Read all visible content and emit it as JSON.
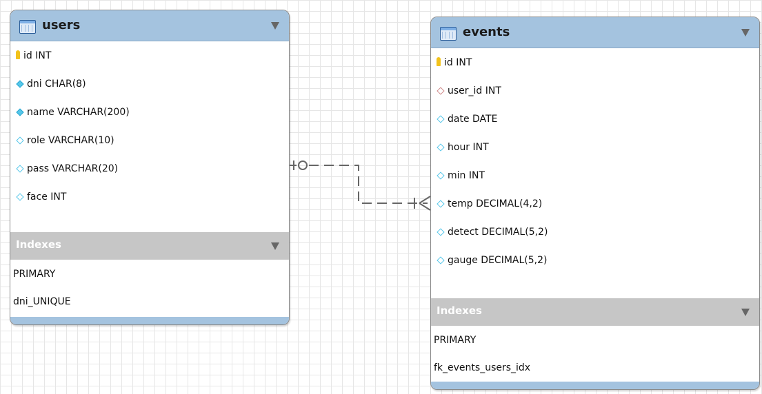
{
  "tables": {
    "users": {
      "name": "users",
      "columns": [
        {
          "text": "id INT",
          "icon": "primary-key-icon"
        },
        {
          "text": "dni CHAR(8)",
          "icon": "not-null-column-icon"
        },
        {
          "text": "name VARCHAR(200)",
          "icon": "not-null-column-icon"
        },
        {
          "text": "role VARCHAR(10)",
          "icon": "nullable-column-icon"
        },
        {
          "text": "pass VARCHAR(20)",
          "icon": "nullable-column-icon"
        },
        {
          "text": "face INT",
          "icon": "nullable-column-icon"
        }
      ],
      "indexes_label": "Indexes",
      "indexes": [
        "PRIMARY",
        "dni_UNIQUE"
      ]
    },
    "events": {
      "name": "events",
      "columns": [
        {
          "text": "id INT",
          "icon": "primary-key-icon"
        },
        {
          "text": "user_id INT",
          "icon": "foreign-key-column-icon"
        },
        {
          "text": "date DATE",
          "icon": "nullable-column-icon"
        },
        {
          "text": "hour INT",
          "icon": "nullable-column-icon"
        },
        {
          "text": "min INT",
          "icon": "nullable-column-icon"
        },
        {
          "text": "temp DECIMAL(4,2)",
          "icon": "nullable-column-icon"
        },
        {
          "text": "detect DECIMAL(5,2)",
          "icon": "nullable-column-icon"
        },
        {
          "text": "gauge DECIMAL(5,2)",
          "icon": "nullable-column-icon"
        }
      ],
      "indexes_label": "Indexes",
      "indexes": [
        "PRIMARY",
        "fk_events_users_idx"
      ]
    }
  },
  "relationship": {
    "from": "users",
    "to": "events",
    "from_cardinality": "zero-or-one",
    "to_cardinality": "one-or-many",
    "line_style": "dashed"
  },
  "colors": {
    "header": "#a4c3df",
    "index_header": "#c6c6c6",
    "primary_key": "#f2c21b",
    "column_diamond": "#56c7ea",
    "foreign_key_diamond": "#d08a8a",
    "relationship_line": "#666666"
  }
}
